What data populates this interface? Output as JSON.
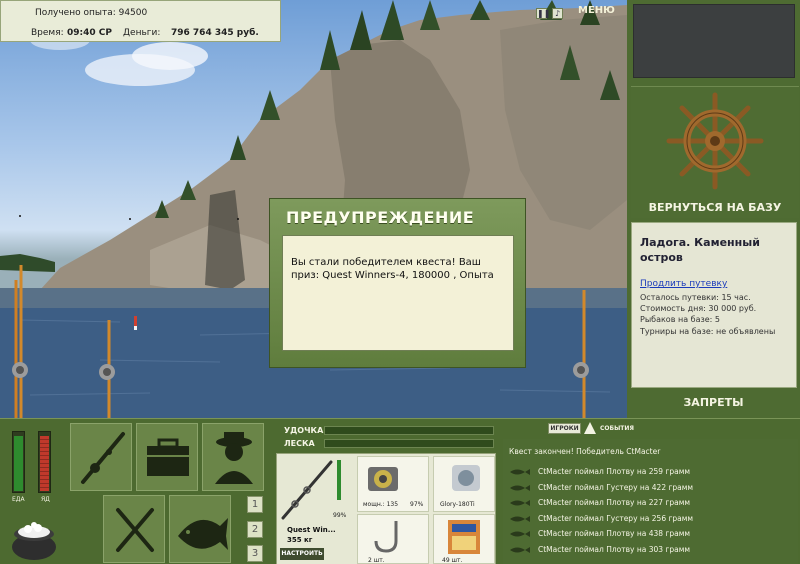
{
  "stats": {
    "experience_label": "Получено опыта: 94500",
    "time_label": "Время:",
    "time_value": "09:40 СР",
    "money_label": "Деньги:",
    "money_value": "796 764 345 руб."
  },
  "topbar": {
    "pause_icon": "pause-icon",
    "sound_icon": "sound-icon",
    "menu_label": "МЕНЮ"
  },
  "right_panel": {
    "return_label": "ВЕРНУТЬСЯ НА БАЗУ",
    "base_title": "Ладога. Каменный остров",
    "extend_link": "Продлить путевку",
    "remaining": "Осталось путевки: 15 час.",
    "day_cost": "Стоимость дня: 30 000 руб.",
    "fishers": "Рыбаков на базе: 5",
    "tournaments": "Турниры на базе: не объявлены",
    "bans_label": "ЗАПРЕТЫ"
  },
  "dialog": {
    "title": "ПРЕДУПРЕЖДЕНИЕ",
    "message": "Вы стали победителем квеста! Ваш приз: Quest Winners-4, 180000 , Опыта"
  },
  "meters": {
    "food_label": "ЕДА",
    "poison_label": "ЯД",
    "food_level": 0.95,
    "poison_level": 0.95,
    "food_color": "#2e8b2e",
    "poison_color": "#c0392b"
  },
  "actions": [
    {
      "name": "action-rod-icon"
    },
    {
      "name": "action-box-icon"
    },
    {
      "name": "action-fisherman-icon"
    },
    {
      "name": "action-food-icon"
    },
    {
      "name": "action-fish-icon"
    }
  ],
  "pages": [
    "1",
    "2",
    "3"
  ],
  "gear": {
    "rod_label": "УДОЧКА",
    "line_label": "ЛЕСКА",
    "rod_condition": "99%",
    "rod_name": "Quest Win...",
    "rod_weight": "355 кг",
    "reel_power": "мощн.: 135",
    "reel_condition": "97%",
    "bait_name": "Glory-180Ti",
    "hook_count": "2 шт.",
    "lure_count": "49 шт.",
    "setup_label": "НАСТРОИТЬ"
  },
  "events": {
    "tab_players": "ИГРОКИ",
    "tab_events": "СОБЫТИЯ",
    "quest_done": "Квест закончен! Победитель CtMacter",
    "items": [
      "CtMacter поймал Плотву на 259 грамм",
      "CtMacter поймал Густеру на 422 грамм",
      "CtMacter поймал Плотву на 227 грамм",
      "CtMacter поймал Густеру на 256 грамм",
      "CtMacter поймал Плотву на 438 грамм",
      "CtMacter поймал Плотву на 303 грамм"
    ]
  },
  "colors": {
    "panel_green": "#4d6a30",
    "accent_cream": "#f3f1d7"
  }
}
